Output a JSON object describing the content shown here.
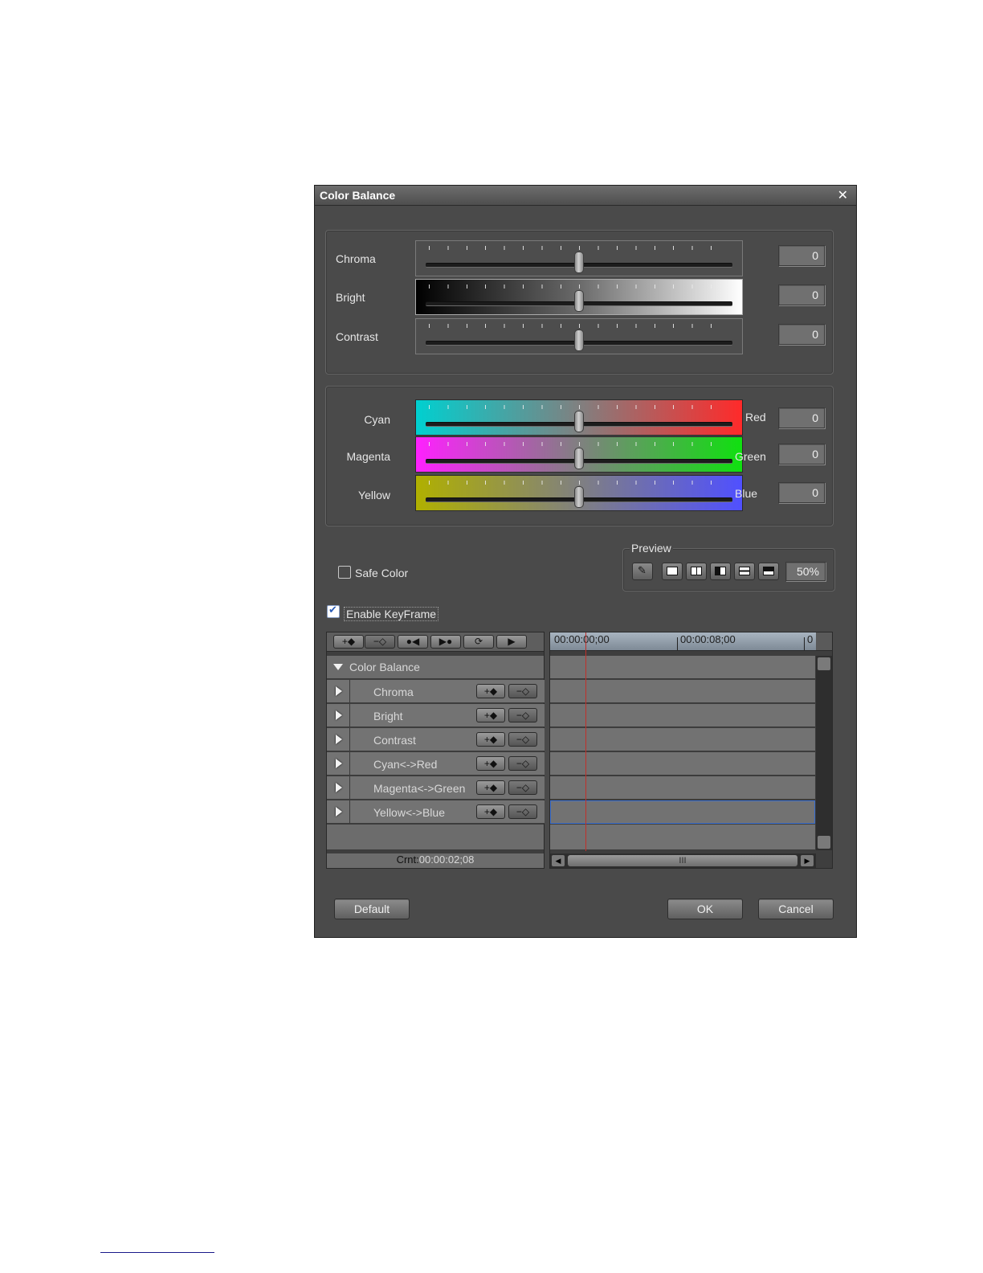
{
  "dialog": {
    "title": "Color Balance",
    "close_glyph": "✕"
  },
  "basic": {
    "sliders": [
      {
        "label": "Chroma",
        "value": "0",
        "position": 0.5
      },
      {
        "label": "Bright",
        "value": "0",
        "position": 0.5
      },
      {
        "label": "Contrast",
        "value": "0",
        "position": 0.5
      }
    ]
  },
  "color": {
    "sliders": [
      {
        "left_label": "Cyan",
        "right_label": "Red",
        "value": "0",
        "position": 0.5
      },
      {
        "left_label": "Magenta",
        "right_label": "Green",
        "value": "0",
        "position": 0.5
      },
      {
        "left_label": "Yellow",
        "right_label": "Blue",
        "value": "0",
        "position": 0.5
      }
    ]
  },
  "safe_color": {
    "label": "Safe Color",
    "checked": false
  },
  "preview": {
    "legend": "Preview",
    "zoom": "50%",
    "buttons": [
      "eyedropper-icon",
      "full-view-icon",
      "split-right-icon",
      "split-left-icon",
      "split-bottom-icon",
      "split-top-icon"
    ]
  },
  "keyframe": {
    "enable_label": "Enable KeyFrame",
    "enabled": true,
    "toolbar": {
      "add": "+◆",
      "remove": "−◇",
      "prev": "●◀",
      "next": "▶●",
      "loop": "⟳",
      "play": "▶"
    },
    "group_label": "Color Balance",
    "tracks": [
      "Chroma",
      "Bright",
      "Contrast",
      "Cyan<->Red",
      "Magenta<->Green",
      "Yellow<->Blue"
    ],
    "row_add": "+◆",
    "row_remove": "−◇",
    "cursor_label": "Crnt:",
    "cursor_time": "00:00:02;08",
    "ruler": {
      "start": "00:00:00;00",
      "mark": "00:00:08;00",
      "end": "0"
    },
    "scrollbar_grip": "III"
  },
  "footer": {
    "default": "Default",
    "ok": "OK",
    "cancel": "Cancel"
  }
}
